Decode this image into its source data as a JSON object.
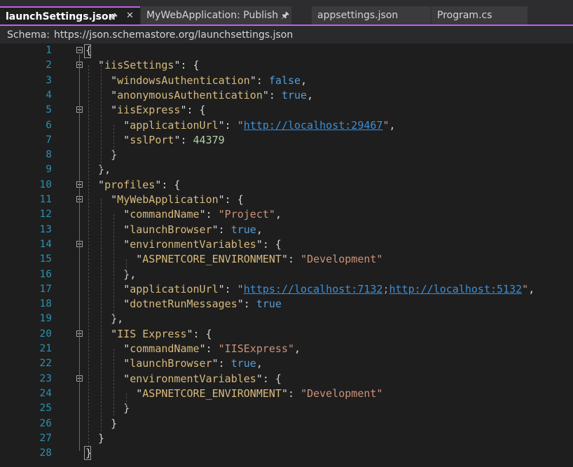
{
  "tabs": [
    {
      "label": "launchSettings.json",
      "active": true,
      "pinned": true,
      "closable": true
    },
    {
      "label": "MyWebApplication: Publish",
      "active": false,
      "pinned": true
    },
    {
      "label": "appsettings.json",
      "active": false
    },
    {
      "label": "Program.cs",
      "active": false
    }
  ],
  "schema": {
    "label": "Schema:",
    "url": "https://json.schemastore.org/launchsettings.json"
  },
  "lines": [
    {
      "num": "1",
      "fold": true,
      "parts": [
        {
          "c": "p",
          "t": "{"
        }
      ]
    },
    {
      "num": "2",
      "fold": true,
      "parts": [
        {
          "c": "p",
          "t": "  \""
        },
        {
          "c": "k",
          "t": "iisSettings"
        },
        {
          "c": "p",
          "t": "\": {"
        }
      ]
    },
    {
      "num": "3",
      "fold": false,
      "parts": [
        {
          "c": "p",
          "t": "    \""
        },
        {
          "c": "k",
          "t": "windowsAuthentication"
        },
        {
          "c": "p",
          "t": "\": "
        },
        {
          "c": "b",
          "t": "false"
        },
        {
          "c": "p",
          "t": ","
        }
      ]
    },
    {
      "num": "4",
      "fold": false,
      "parts": [
        {
          "c": "p",
          "t": "    \""
        },
        {
          "c": "k",
          "t": "anonymousAuthentication"
        },
        {
          "c": "p",
          "t": "\": "
        },
        {
          "c": "b",
          "t": "true"
        },
        {
          "c": "p",
          "t": ","
        }
      ]
    },
    {
      "num": "5",
      "fold": true,
      "parts": [
        {
          "c": "p",
          "t": "    \""
        },
        {
          "c": "k",
          "t": "iisExpress"
        },
        {
          "c": "p",
          "t": "\": {"
        }
      ]
    },
    {
      "num": "6",
      "fold": false,
      "parts": [
        {
          "c": "p",
          "t": "      \""
        },
        {
          "c": "k",
          "t": "applicationUrl"
        },
        {
          "c": "p",
          "t": "\": "
        },
        {
          "c": "s",
          "t": "\""
        },
        {
          "c": "u",
          "t": "http://localhost:29467"
        },
        {
          "c": "s",
          "t": "\""
        },
        {
          "c": "p",
          "t": ","
        }
      ]
    },
    {
      "num": "7",
      "fold": false,
      "parts": [
        {
          "c": "p",
          "t": "      \""
        },
        {
          "c": "k",
          "t": "sslPort"
        },
        {
          "c": "p",
          "t": "\": "
        },
        {
          "c": "n",
          "t": "44379"
        }
      ]
    },
    {
      "num": "8",
      "fold": false,
      "parts": [
        {
          "c": "p",
          "t": "    }"
        }
      ]
    },
    {
      "num": "9",
      "fold": false,
      "parts": [
        {
          "c": "p",
          "t": "  },"
        }
      ]
    },
    {
      "num": "10",
      "fold": true,
      "parts": [
        {
          "c": "p",
          "t": "  \""
        },
        {
          "c": "k",
          "t": "profiles"
        },
        {
          "c": "p",
          "t": "\": {"
        }
      ]
    },
    {
      "num": "11",
      "fold": true,
      "parts": [
        {
          "c": "p",
          "t": "    \""
        },
        {
          "c": "k",
          "t": "MyWebApplication"
        },
        {
          "c": "p",
          "t": "\": {"
        }
      ]
    },
    {
      "num": "12",
      "fold": false,
      "parts": [
        {
          "c": "p",
          "t": "      \""
        },
        {
          "c": "k",
          "t": "commandName"
        },
        {
          "c": "p",
          "t": "\": "
        },
        {
          "c": "s",
          "t": "\"Project\""
        },
        {
          "c": "p",
          "t": ","
        }
      ]
    },
    {
      "num": "13",
      "fold": false,
      "parts": [
        {
          "c": "p",
          "t": "      \""
        },
        {
          "c": "k",
          "t": "launchBrowser"
        },
        {
          "c": "p",
          "t": "\": "
        },
        {
          "c": "b",
          "t": "true"
        },
        {
          "c": "p",
          "t": ","
        }
      ]
    },
    {
      "num": "14",
      "fold": true,
      "parts": [
        {
          "c": "p",
          "t": "      \""
        },
        {
          "c": "k",
          "t": "environmentVariables"
        },
        {
          "c": "p",
          "t": "\": {"
        }
      ]
    },
    {
      "num": "15",
      "fold": false,
      "parts": [
        {
          "c": "p",
          "t": "        \""
        },
        {
          "c": "k",
          "t": "ASPNETCORE_ENVIRONMENT"
        },
        {
          "c": "p",
          "t": "\": "
        },
        {
          "c": "s",
          "t": "\"Development\""
        }
      ]
    },
    {
      "num": "16",
      "fold": false,
      "parts": [
        {
          "c": "p",
          "t": "      },"
        }
      ]
    },
    {
      "num": "17",
      "fold": false,
      "parts": [
        {
          "c": "p",
          "t": "      \""
        },
        {
          "c": "k",
          "t": "applicationUrl"
        },
        {
          "c": "p",
          "t": "\": "
        },
        {
          "c": "s",
          "t": "\""
        },
        {
          "c": "u",
          "t": "https://localhost:7132"
        },
        {
          "c": "s",
          "t": ";"
        },
        {
          "c": "u",
          "t": "http://localhost:5132"
        },
        {
          "c": "s",
          "t": "\""
        },
        {
          "c": "p",
          "t": ","
        }
      ]
    },
    {
      "num": "18",
      "fold": false,
      "parts": [
        {
          "c": "p",
          "t": "      \""
        },
        {
          "c": "k",
          "t": "dotnetRunMessages"
        },
        {
          "c": "p",
          "t": "\": "
        },
        {
          "c": "b",
          "t": "true"
        }
      ]
    },
    {
      "num": "19",
      "fold": false,
      "parts": [
        {
          "c": "p",
          "t": "    },"
        }
      ]
    },
    {
      "num": "20",
      "fold": true,
      "parts": [
        {
          "c": "p",
          "t": "    \""
        },
        {
          "c": "k",
          "t": "IIS Express"
        },
        {
          "c": "p",
          "t": "\": {"
        }
      ]
    },
    {
      "num": "21",
      "fold": false,
      "parts": [
        {
          "c": "p",
          "t": "      \""
        },
        {
          "c": "k",
          "t": "commandName"
        },
        {
          "c": "p",
          "t": "\": "
        },
        {
          "c": "s",
          "t": "\"IISExpress\""
        },
        {
          "c": "p",
          "t": ","
        }
      ]
    },
    {
      "num": "22",
      "fold": false,
      "parts": [
        {
          "c": "p",
          "t": "      \""
        },
        {
          "c": "k",
          "t": "launchBrowser"
        },
        {
          "c": "p",
          "t": "\": "
        },
        {
          "c": "b",
          "t": "true"
        },
        {
          "c": "p",
          "t": ","
        }
      ]
    },
    {
      "num": "23",
      "fold": true,
      "parts": [
        {
          "c": "p",
          "t": "      \""
        },
        {
          "c": "k",
          "t": "environmentVariables"
        },
        {
          "c": "p",
          "t": "\": {"
        }
      ]
    },
    {
      "num": "24",
      "fold": false,
      "parts": [
        {
          "c": "p",
          "t": "        \""
        },
        {
          "c": "k",
          "t": "ASPNETCORE_ENVIRONMENT"
        },
        {
          "c": "p",
          "t": "\": "
        },
        {
          "c": "s",
          "t": "\"Development\""
        }
      ]
    },
    {
      "num": "25",
      "fold": false,
      "parts": [
        {
          "c": "p",
          "t": "      }"
        }
      ]
    },
    {
      "num": "26",
      "fold": false,
      "parts": [
        {
          "c": "p",
          "t": "    }"
        }
      ]
    },
    {
      "num": "27",
      "fold": false,
      "parts": [
        {
          "c": "p",
          "t": "  }"
        }
      ]
    },
    {
      "num": "28",
      "fold": false,
      "parts": [
        {
          "c": "p",
          "t": "}"
        }
      ]
    }
  ],
  "colors": {
    "accent": "#c05ff0",
    "line_number": "#2b91af",
    "key": "#d7ba7d",
    "string": "#ce9178",
    "boolean": "#569cd6",
    "number": "#b5cea8",
    "link": "#3c8fd8"
  }
}
